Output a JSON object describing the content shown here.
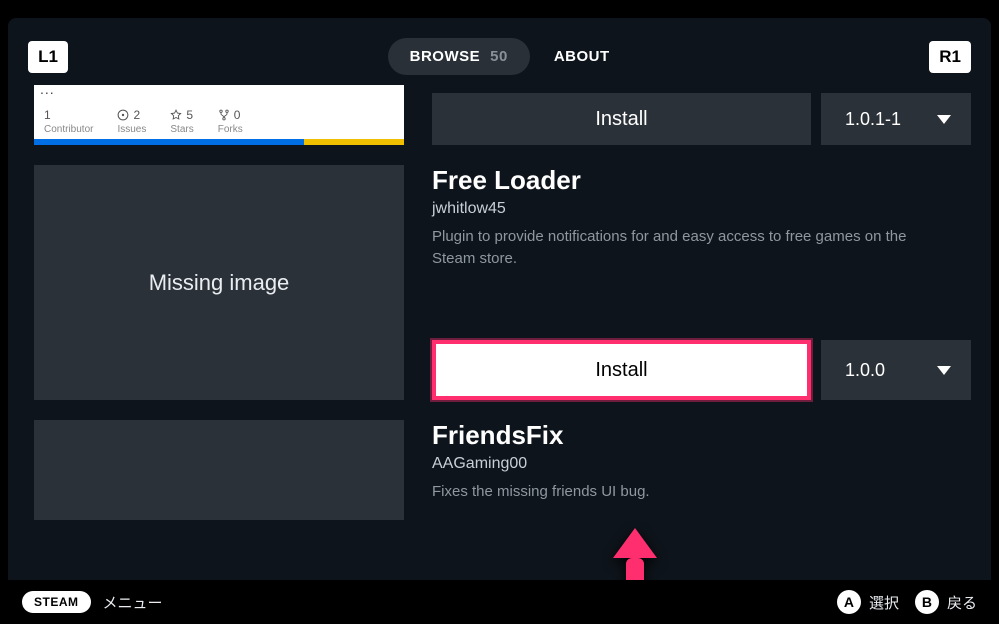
{
  "bumpers": {
    "left": "L1",
    "right": "R1"
  },
  "tabs": {
    "browse_label": "BROWSE",
    "browse_count": "50",
    "about_label": "ABOUT"
  },
  "item0": {
    "install_label": "Install",
    "version": "1.0.1-1",
    "preview": {
      "contrib_n": "1",
      "contrib_label": "Contributor",
      "issues_n": "2",
      "issues_label": "Issues",
      "stars_n": "5",
      "stars_label": "Stars",
      "forks_n": "0",
      "forks_label": "Forks"
    }
  },
  "item1": {
    "title": "Free Loader",
    "author": "jwhitlow45",
    "desc": "Plugin to provide notifications for and easy access to free games on the Steam store.",
    "thumb_text": "Missing image",
    "install_label": "Install",
    "version": "1.0.0"
  },
  "item2": {
    "title": "FriendsFix",
    "author": "AAGaming00",
    "desc": "Fixes the missing friends UI bug."
  },
  "footer": {
    "steam": "STEAM",
    "menu": "メニュー",
    "a_btn": "A",
    "a_label": "選択",
    "b_btn": "B",
    "b_label": "戻る"
  }
}
